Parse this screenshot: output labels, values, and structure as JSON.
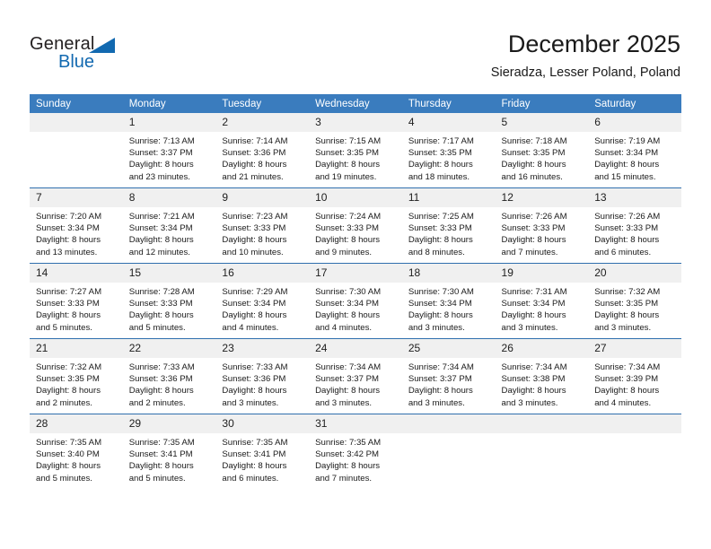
{
  "brand": {
    "name_dark": "General",
    "name_blue": "Blue",
    "accent_color": "#1269b0"
  },
  "header": {
    "title": "December 2025",
    "subtitle": "Sieradza, Lesser Poland, Poland"
  },
  "theme": {
    "header_row_bg": "#3a7cbe",
    "header_row_text": "#ffffff",
    "daynum_bg": "#f0f0f0",
    "row_divider": "#2f6fae"
  },
  "weekdays": [
    "Sunday",
    "Monday",
    "Tuesday",
    "Wednesday",
    "Thursday",
    "Friday",
    "Saturday"
  ],
  "weeks": [
    [
      {
        "day": "",
        "sunrise": "",
        "sunset": "",
        "daylight_line1": "",
        "daylight_line2": ""
      },
      {
        "day": "1",
        "sunrise": "Sunrise: 7:13 AM",
        "sunset": "Sunset: 3:37 PM",
        "daylight_line1": "Daylight: 8 hours",
        "daylight_line2": "and 23 minutes."
      },
      {
        "day": "2",
        "sunrise": "Sunrise: 7:14 AM",
        "sunset": "Sunset: 3:36 PM",
        "daylight_line1": "Daylight: 8 hours",
        "daylight_line2": "and 21 minutes."
      },
      {
        "day": "3",
        "sunrise": "Sunrise: 7:15 AM",
        "sunset": "Sunset: 3:35 PM",
        "daylight_line1": "Daylight: 8 hours",
        "daylight_line2": "and 19 minutes."
      },
      {
        "day": "4",
        "sunrise": "Sunrise: 7:17 AM",
        "sunset": "Sunset: 3:35 PM",
        "daylight_line1": "Daylight: 8 hours",
        "daylight_line2": "and 18 minutes."
      },
      {
        "day": "5",
        "sunrise": "Sunrise: 7:18 AM",
        "sunset": "Sunset: 3:35 PM",
        "daylight_line1": "Daylight: 8 hours",
        "daylight_line2": "and 16 minutes."
      },
      {
        "day": "6",
        "sunrise": "Sunrise: 7:19 AM",
        "sunset": "Sunset: 3:34 PM",
        "daylight_line1": "Daylight: 8 hours",
        "daylight_line2": "and 15 minutes."
      }
    ],
    [
      {
        "day": "7",
        "sunrise": "Sunrise: 7:20 AM",
        "sunset": "Sunset: 3:34 PM",
        "daylight_line1": "Daylight: 8 hours",
        "daylight_line2": "and 13 minutes."
      },
      {
        "day": "8",
        "sunrise": "Sunrise: 7:21 AM",
        "sunset": "Sunset: 3:34 PM",
        "daylight_line1": "Daylight: 8 hours",
        "daylight_line2": "and 12 minutes."
      },
      {
        "day": "9",
        "sunrise": "Sunrise: 7:23 AM",
        "sunset": "Sunset: 3:33 PM",
        "daylight_line1": "Daylight: 8 hours",
        "daylight_line2": "and 10 minutes."
      },
      {
        "day": "10",
        "sunrise": "Sunrise: 7:24 AM",
        "sunset": "Sunset: 3:33 PM",
        "daylight_line1": "Daylight: 8 hours",
        "daylight_line2": "and 9 minutes."
      },
      {
        "day": "11",
        "sunrise": "Sunrise: 7:25 AM",
        "sunset": "Sunset: 3:33 PM",
        "daylight_line1": "Daylight: 8 hours",
        "daylight_line2": "and 8 minutes."
      },
      {
        "day": "12",
        "sunrise": "Sunrise: 7:26 AM",
        "sunset": "Sunset: 3:33 PM",
        "daylight_line1": "Daylight: 8 hours",
        "daylight_line2": "and 7 minutes."
      },
      {
        "day": "13",
        "sunrise": "Sunrise: 7:26 AM",
        "sunset": "Sunset: 3:33 PM",
        "daylight_line1": "Daylight: 8 hours",
        "daylight_line2": "and 6 minutes."
      }
    ],
    [
      {
        "day": "14",
        "sunrise": "Sunrise: 7:27 AM",
        "sunset": "Sunset: 3:33 PM",
        "daylight_line1": "Daylight: 8 hours",
        "daylight_line2": "and 5 minutes."
      },
      {
        "day": "15",
        "sunrise": "Sunrise: 7:28 AM",
        "sunset": "Sunset: 3:33 PM",
        "daylight_line1": "Daylight: 8 hours",
        "daylight_line2": "and 5 minutes."
      },
      {
        "day": "16",
        "sunrise": "Sunrise: 7:29 AM",
        "sunset": "Sunset: 3:34 PM",
        "daylight_line1": "Daylight: 8 hours",
        "daylight_line2": "and 4 minutes."
      },
      {
        "day": "17",
        "sunrise": "Sunrise: 7:30 AM",
        "sunset": "Sunset: 3:34 PM",
        "daylight_line1": "Daylight: 8 hours",
        "daylight_line2": "and 4 minutes."
      },
      {
        "day": "18",
        "sunrise": "Sunrise: 7:30 AM",
        "sunset": "Sunset: 3:34 PM",
        "daylight_line1": "Daylight: 8 hours",
        "daylight_line2": "and 3 minutes."
      },
      {
        "day": "19",
        "sunrise": "Sunrise: 7:31 AM",
        "sunset": "Sunset: 3:34 PM",
        "daylight_line1": "Daylight: 8 hours",
        "daylight_line2": "and 3 minutes."
      },
      {
        "day": "20",
        "sunrise": "Sunrise: 7:32 AM",
        "sunset": "Sunset: 3:35 PM",
        "daylight_line1": "Daylight: 8 hours",
        "daylight_line2": "and 3 minutes."
      }
    ],
    [
      {
        "day": "21",
        "sunrise": "Sunrise: 7:32 AM",
        "sunset": "Sunset: 3:35 PM",
        "daylight_line1": "Daylight: 8 hours",
        "daylight_line2": "and 2 minutes."
      },
      {
        "day": "22",
        "sunrise": "Sunrise: 7:33 AM",
        "sunset": "Sunset: 3:36 PM",
        "daylight_line1": "Daylight: 8 hours",
        "daylight_line2": "and 2 minutes."
      },
      {
        "day": "23",
        "sunrise": "Sunrise: 7:33 AM",
        "sunset": "Sunset: 3:36 PM",
        "daylight_line1": "Daylight: 8 hours",
        "daylight_line2": "and 3 minutes."
      },
      {
        "day": "24",
        "sunrise": "Sunrise: 7:34 AM",
        "sunset": "Sunset: 3:37 PM",
        "daylight_line1": "Daylight: 8 hours",
        "daylight_line2": "and 3 minutes."
      },
      {
        "day": "25",
        "sunrise": "Sunrise: 7:34 AM",
        "sunset": "Sunset: 3:37 PM",
        "daylight_line1": "Daylight: 8 hours",
        "daylight_line2": "and 3 minutes."
      },
      {
        "day": "26",
        "sunrise": "Sunrise: 7:34 AM",
        "sunset": "Sunset: 3:38 PM",
        "daylight_line1": "Daylight: 8 hours",
        "daylight_line2": "and 3 minutes."
      },
      {
        "day": "27",
        "sunrise": "Sunrise: 7:34 AM",
        "sunset": "Sunset: 3:39 PM",
        "daylight_line1": "Daylight: 8 hours",
        "daylight_line2": "and 4 minutes."
      }
    ],
    [
      {
        "day": "28",
        "sunrise": "Sunrise: 7:35 AM",
        "sunset": "Sunset: 3:40 PM",
        "daylight_line1": "Daylight: 8 hours",
        "daylight_line2": "and 5 minutes."
      },
      {
        "day": "29",
        "sunrise": "Sunrise: 7:35 AM",
        "sunset": "Sunset: 3:41 PM",
        "daylight_line1": "Daylight: 8 hours",
        "daylight_line2": "and 5 minutes."
      },
      {
        "day": "30",
        "sunrise": "Sunrise: 7:35 AM",
        "sunset": "Sunset: 3:41 PM",
        "daylight_line1": "Daylight: 8 hours",
        "daylight_line2": "and 6 minutes."
      },
      {
        "day": "31",
        "sunrise": "Sunrise: 7:35 AM",
        "sunset": "Sunset: 3:42 PM",
        "daylight_line1": "Daylight: 8 hours",
        "daylight_line2": "and 7 minutes."
      },
      {
        "day": "",
        "sunrise": "",
        "sunset": "",
        "daylight_line1": "",
        "daylight_line2": ""
      },
      {
        "day": "",
        "sunrise": "",
        "sunset": "",
        "daylight_line1": "",
        "daylight_line2": ""
      },
      {
        "day": "",
        "sunrise": "",
        "sunset": "",
        "daylight_line1": "",
        "daylight_line2": ""
      }
    ]
  ]
}
